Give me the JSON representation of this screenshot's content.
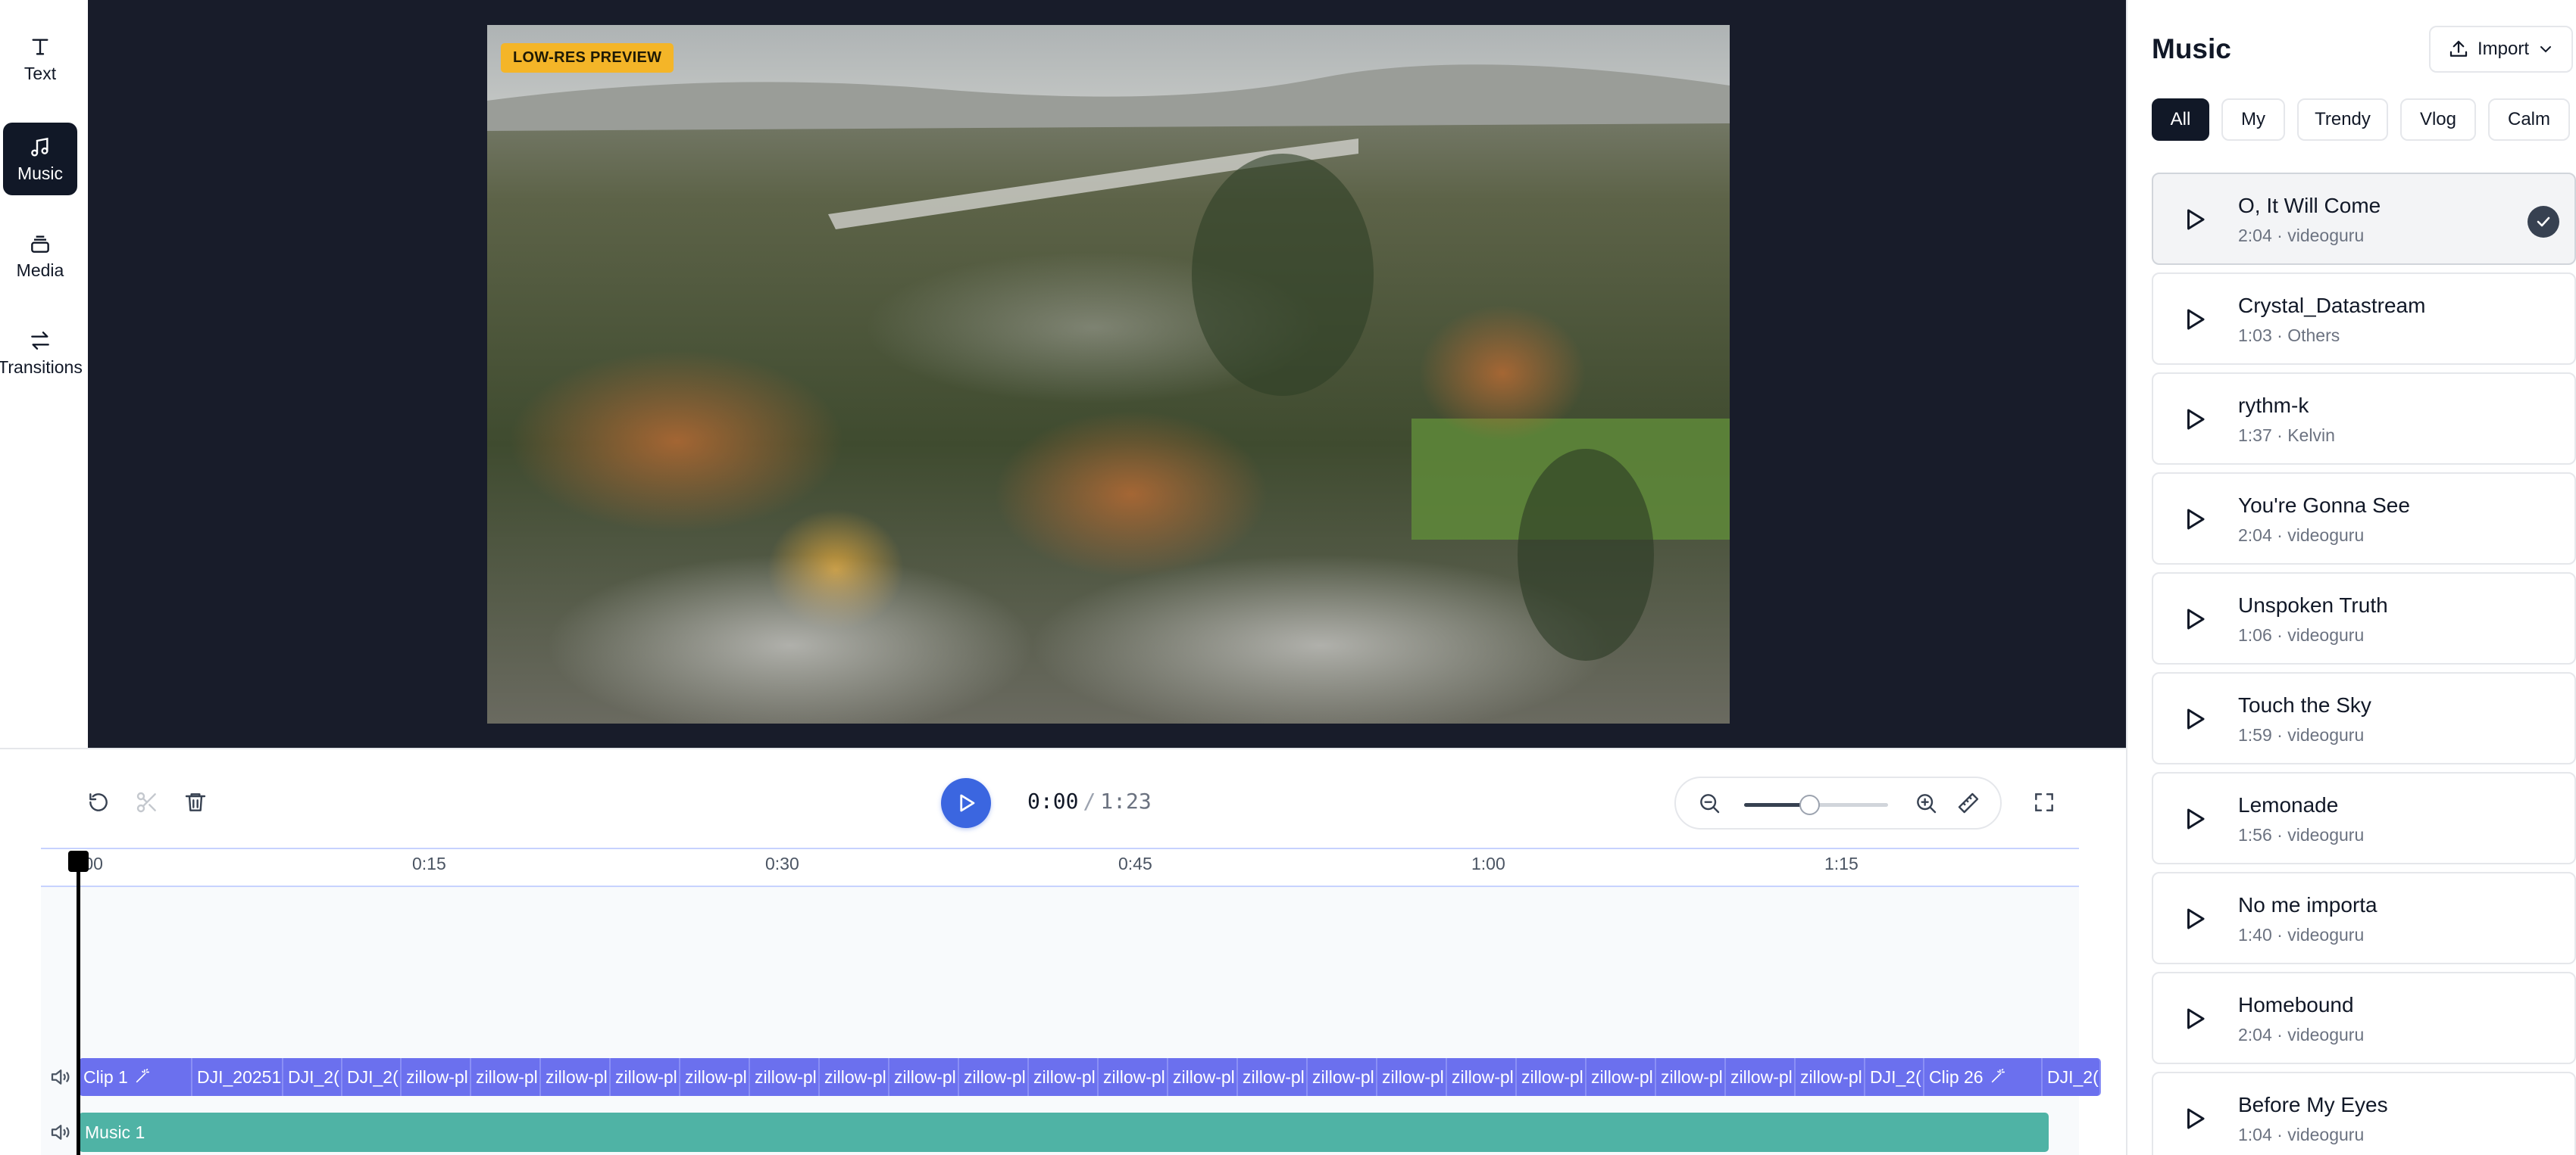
{
  "toolbar": {
    "items": [
      {
        "label": "Text",
        "icon": "text-icon",
        "active": false
      },
      {
        "label": "Music",
        "icon": "music-note-icon",
        "active": true
      },
      {
        "label": "Media",
        "icon": "media-stack-icon",
        "active": false
      },
      {
        "label": "Transitions",
        "icon": "transitions-arrows-icon",
        "active": false
      }
    ]
  },
  "preview": {
    "badge": "LOW-RES PREVIEW"
  },
  "controls": {
    "time_current": "0:00",
    "time_separator": "/",
    "time_total": "1:23",
    "zoom_level": 0.45,
    "accent_color": "#3b66e0"
  },
  "timeline": {
    "ticks": [
      ":00",
      "0:15",
      "0:30",
      "0:45",
      "1:00",
      "1:15"
    ],
    "video_clips": [
      "Clip 1",
      "DJI_20251",
      "DJI_2(",
      "DJI_2(",
      "zillow-pl",
      "zillow-pl",
      "zillow-pl",
      "zillow-pl",
      "zillow-pl",
      "zillow-pl",
      "zillow-pl",
      "zillow-pl",
      "zillow-pl",
      "zillow-pl",
      "zillow-pl",
      "zillow-pl",
      "zillow-pl",
      "zillow-pl",
      "zillow-pl",
      "zillow-pl",
      "zillow-pl",
      "zillow-pl",
      "zillow-pl",
      "zillow-pl",
      "zillow-pl",
      "DJI_2(",
      "Clip 26",
      "DJI_2("
    ],
    "music_clip": "Music 1",
    "video_clip_color": "#6b70ee",
    "music_clip_color": "#4fb3a5"
  },
  "music_panel": {
    "title": "Music",
    "import_label": "Import",
    "categories": [
      "All",
      "My",
      "Trendy",
      "Vlog",
      "Calm"
    ],
    "active_category": "All",
    "tracks": [
      {
        "name": "O, It Will Come",
        "duration": "2:04",
        "source": "videoguru",
        "selected": true
      },
      {
        "name": "Crystal_Datastream",
        "duration": "1:03",
        "source": "Others"
      },
      {
        "name": "rythm-k",
        "duration": "1:37",
        "source": "Kelvin"
      },
      {
        "name": "You're Gonna See",
        "duration": "2:04",
        "source": "videoguru"
      },
      {
        "name": "Unspoken Truth",
        "duration": "1:06",
        "source": "videoguru"
      },
      {
        "name": "Touch the Sky",
        "duration": "1:59",
        "source": "videoguru"
      },
      {
        "name": "Lemonade",
        "duration": "1:56",
        "source": "videoguru"
      },
      {
        "name": "No me importa",
        "duration": "1:40",
        "source": "videoguru"
      },
      {
        "name": "Homebound",
        "duration": "2:04",
        "source": "videoguru"
      },
      {
        "name": "Before My Eyes",
        "duration": "1:04",
        "source": "videoguru"
      }
    ]
  }
}
